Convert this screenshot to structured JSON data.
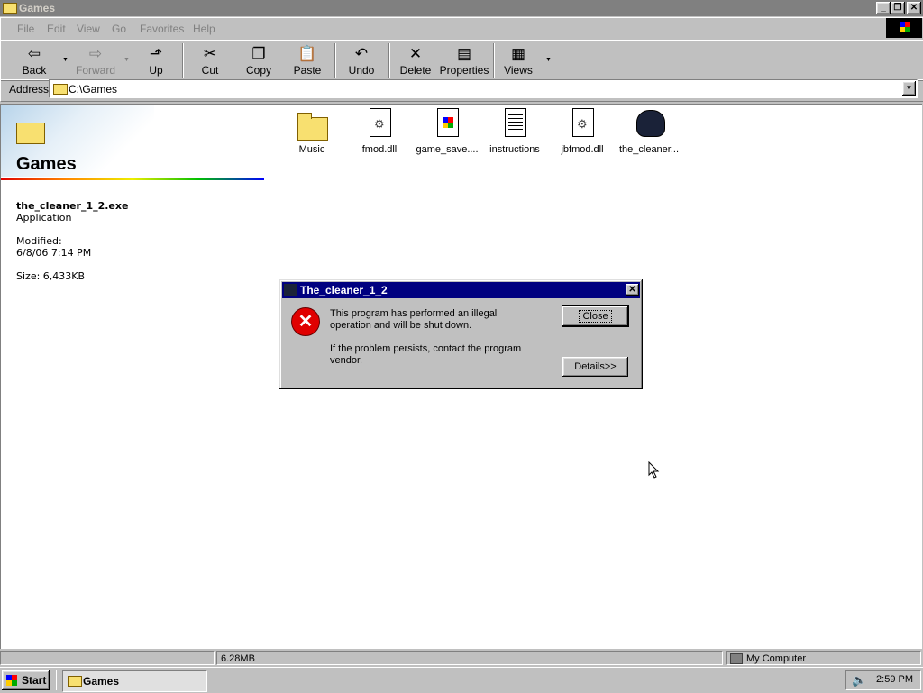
{
  "window": {
    "title": "Games"
  },
  "menu": {
    "items": [
      "File",
      "Edit",
      "View",
      "Go",
      "Favorites",
      "Help"
    ]
  },
  "toolbar": {
    "back": "Back",
    "forward": "Forward",
    "up": "Up",
    "cut": "Cut",
    "copy": "Copy",
    "paste": "Paste",
    "undo": "Undo",
    "delete": "Delete",
    "properties": "Properties",
    "views": "Views"
  },
  "address": {
    "label": "Address",
    "value": "C:\\Games"
  },
  "leftpane": {
    "folder_title": "Games",
    "selected_name": "the_cleaner_1_2.exe",
    "selected_type": "Application",
    "modified_label": "Modified:",
    "modified_value": "6/8/06 7:14 PM",
    "size": "Size: 6,433KB"
  },
  "files": [
    "Music",
    "fmod.dll",
    "game_save....",
    "instructions",
    "jbfmod.dll",
    "the_cleaner..."
  ],
  "dialog": {
    "title": "The_cleaner_1_2",
    "message1": "This program has performed an illegal operation and will be shut down.",
    "message2": "If the problem persists, contact the program vendor.",
    "close_label": "Close",
    "details_label": "Details>>"
  },
  "status": {
    "size": "6.28MB",
    "zone": "My Computer"
  },
  "taskbar": {
    "start": "Start",
    "task": "Games",
    "clock": "2:59 PM"
  },
  "colors": {
    "dialog_title": "#000080",
    "error": "#e00000",
    "face": "#c0c0c0"
  }
}
